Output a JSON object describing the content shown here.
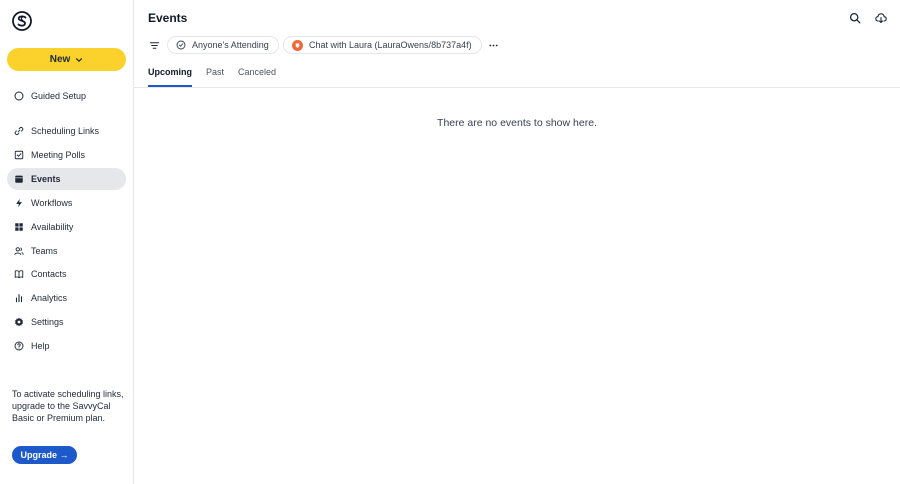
{
  "sidebar": {
    "logo": "savvycal-logo-icon",
    "new_label": "New",
    "items": [
      {
        "label": "Guided Setup",
        "icon": "circle-icon",
        "active": false
      },
      {
        "label": "Scheduling Links",
        "icon": "link-icon",
        "active": false
      },
      {
        "label": "Meeting Polls",
        "icon": "checkbox-icon",
        "active": false
      },
      {
        "label": "Events",
        "icon": "calendar-icon",
        "active": true
      },
      {
        "label": "Workflows",
        "icon": "bolt-icon",
        "active": false
      },
      {
        "label": "Availability",
        "icon": "grid-icon",
        "active": false
      },
      {
        "label": "Teams",
        "icon": "users-icon",
        "active": false
      },
      {
        "label": "Contacts",
        "icon": "book-icon",
        "active": false
      },
      {
        "label": "Analytics",
        "icon": "bar-chart-icon",
        "active": false
      },
      {
        "label": "Settings",
        "icon": "gear-icon",
        "active": false
      },
      {
        "label": "Help",
        "icon": "help-icon",
        "active": false
      }
    ],
    "upgrade_text": "To activate scheduling links, upgrade to the SavvyCal Basic or Premium plan.",
    "upgrade_label": "Upgrade →"
  },
  "header": {
    "title": "Events"
  },
  "filters": {
    "attendance_label": "Anyone's Attending",
    "calendar_label": "Chat with Laura (LauraOwens/8b737a4f)"
  },
  "tabs": [
    {
      "label": "Upcoming",
      "active": true
    },
    {
      "label": "Past",
      "active": false
    },
    {
      "label": "Canceled",
      "active": false
    }
  ],
  "empty_message": "There are no events to show here.",
  "colors": {
    "accent": "#fbd12b",
    "primary": "#1d59c9",
    "active_bg": "#e5e7eb",
    "avatar": "#f0683a"
  }
}
